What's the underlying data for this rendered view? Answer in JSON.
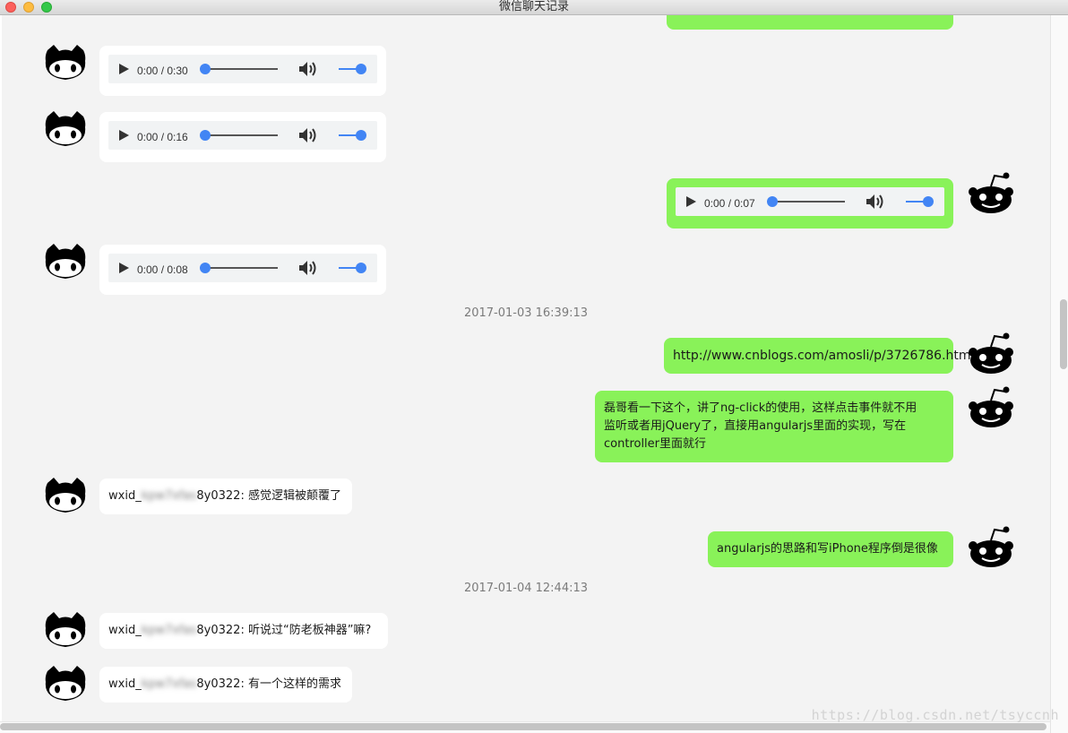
{
  "window": {
    "title": "微信聊天记录"
  },
  "messages": {
    "audio_1": {
      "time": "0:00 / 0:30"
    },
    "audio_2": {
      "time": "0:00 / 0:16"
    },
    "audio_3": {
      "time": "0:00 / 0:07"
    },
    "audio_4": {
      "time": "0:00 / 0:08"
    },
    "timestamp_1": "2017-01-03 16:39:13",
    "link_msg": "http://www.cnblogs.com/amosli/p/3726786.html",
    "long_msg": {
      "line1": "磊哥看一下这个，讲了ng-click的使用，这样点击事件就不用",
      "line2": "监听或者用jQuery了，直接用angularjs里面的实现，写在",
      "line3": "controller里面就行"
    },
    "msg_feel": {
      "prefix": "wxid_",
      "hidden": "kpw7xfas",
      "suffix": "8y0322: 感觉逻辑被颠覆了"
    },
    "msg_iphone": "angularjs的思路和写iPhone程序倒是很像",
    "timestamp_2": "2017-01-04 12:44:13",
    "msg_heard": {
      "prefix": "wxid_",
      "hidden": "kpw7xfas",
      "suffix": "8y0322: 听说过“防老板神器”嘛?"
    },
    "msg_need": {
      "prefix": "wxid_",
      "hidden": "kpw7xfas",
      "suffix": "8y0322: 有一个这样的需求"
    }
  },
  "watermark": "https://blog.csdn.net/tsyccnh",
  "colors": {
    "outgoing": "#89f259",
    "incoming": "#ffffff",
    "background": "#f3f3f3",
    "accent": "#4285f4"
  },
  "icons": {
    "left_avatar": "github-octocat-icon",
    "right_avatar": "reddit-alien-icon"
  }
}
